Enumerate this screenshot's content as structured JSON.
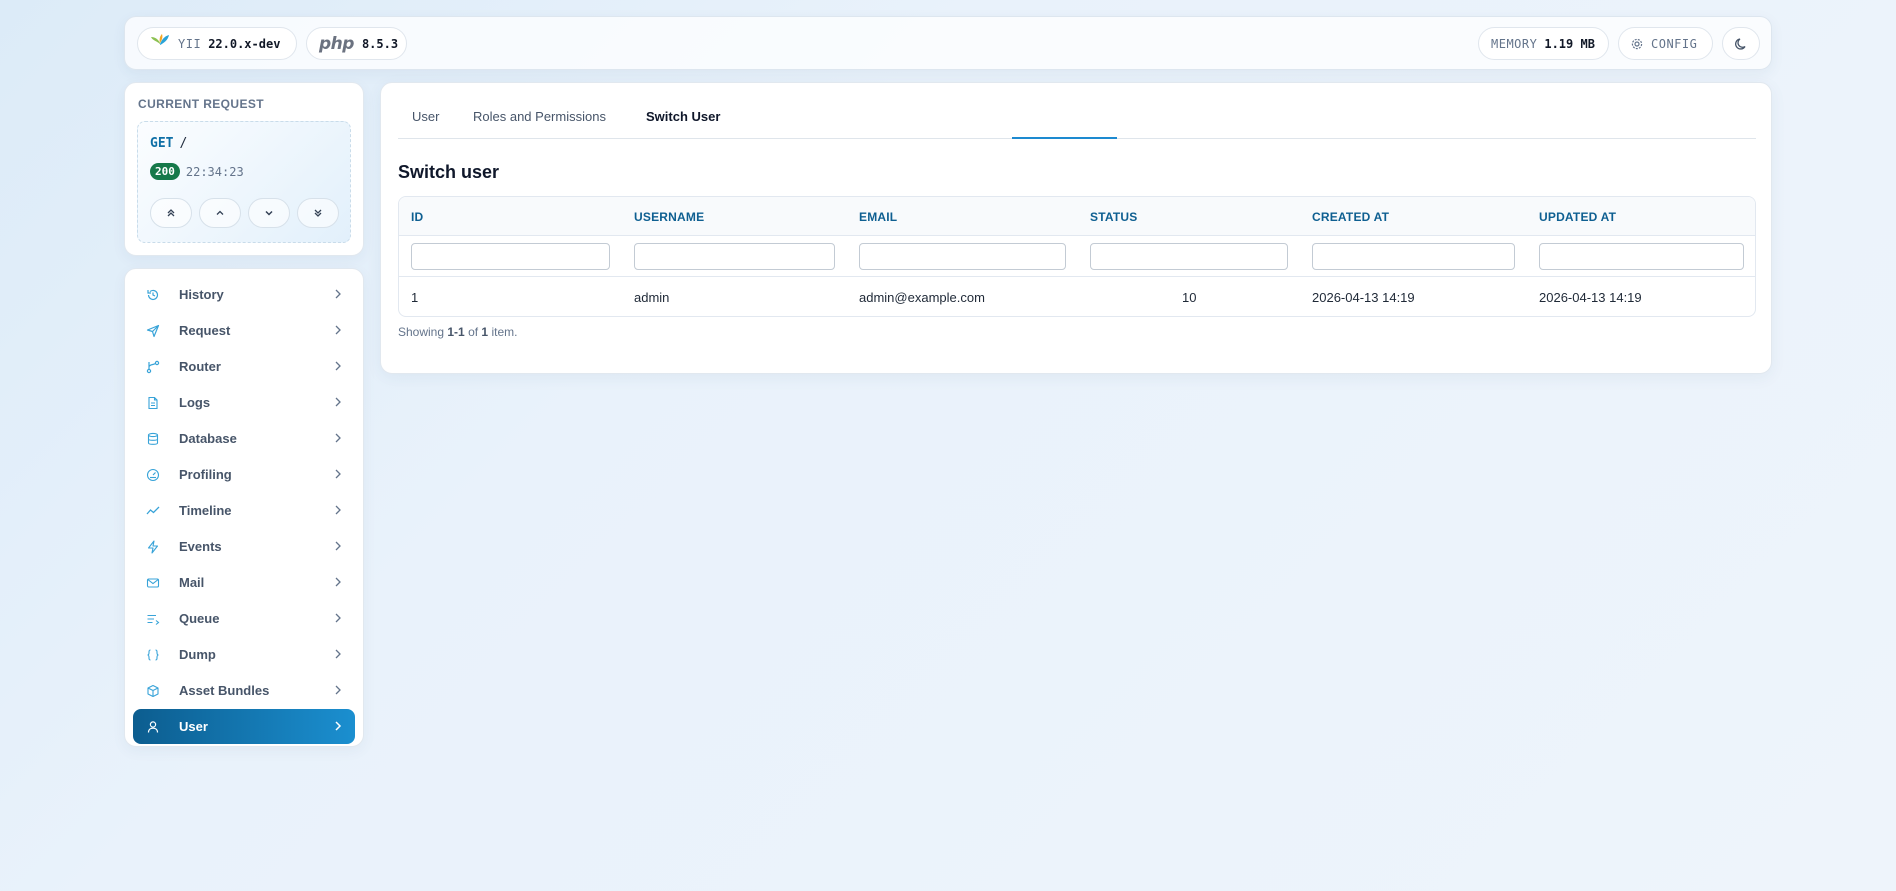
{
  "topbar": {
    "yii_label": "YII",
    "yii_version": "22.0.x-dev",
    "php_label": "php",
    "php_version": "8.5.3",
    "memory_label": "MEMORY",
    "memory_value": "1.19 MB",
    "config_label": "CONFIG",
    "theme_icon": "moon-icon"
  },
  "request": {
    "title": "CURRENT REQUEST",
    "method": "GET",
    "path": "/",
    "status": "200",
    "time": "22:34:23",
    "nav_icons": [
      "chevrons-up-icon",
      "chevron-up-icon",
      "chevron-down-icon",
      "chevrons-down-icon"
    ]
  },
  "sidebar": {
    "items": [
      {
        "label": "History",
        "icon": "history-icon"
      },
      {
        "label": "Request",
        "icon": "send-icon"
      },
      {
        "label": "Router",
        "icon": "route-icon"
      },
      {
        "label": "Logs",
        "icon": "file-icon"
      },
      {
        "label": "Database",
        "icon": "database-icon"
      },
      {
        "label": "Profiling",
        "icon": "gauge-icon"
      },
      {
        "label": "Timeline",
        "icon": "trend-icon"
      },
      {
        "label": "Events",
        "icon": "bolt-icon"
      },
      {
        "label": "Mail",
        "icon": "mail-icon"
      },
      {
        "label": "Queue",
        "icon": "queue-icon"
      },
      {
        "label": "Dump",
        "icon": "braces-icon"
      },
      {
        "label": "Asset Bundles",
        "icon": "package-icon"
      },
      {
        "label": "User",
        "icon": "user-icon",
        "active": true
      }
    ]
  },
  "main": {
    "tabs": [
      {
        "label": "User"
      },
      {
        "label": "Roles and Permissions"
      },
      {
        "label": "Switch User",
        "active": true
      }
    ],
    "title": "Switch user",
    "table": {
      "headers": [
        "ID",
        "USERNAME",
        "EMAIL",
        "STATUS",
        "CREATED AT",
        "UPDATED AT"
      ],
      "rows": [
        [
          "1",
          "admin",
          "admin@example.com",
          "10",
          "2026-04-13 14:19",
          "2026-04-13 14:19"
        ]
      ]
    },
    "summary": {
      "prefix": "Showing",
      "range": "1-1",
      "of": "of",
      "total": "1",
      "suffix": "item."
    }
  },
  "colors": {
    "accent": "#1b8fd0",
    "accent_dark": "#0c5d8f",
    "status_ok": "#16794a",
    "header_text": "#0e5f91"
  }
}
